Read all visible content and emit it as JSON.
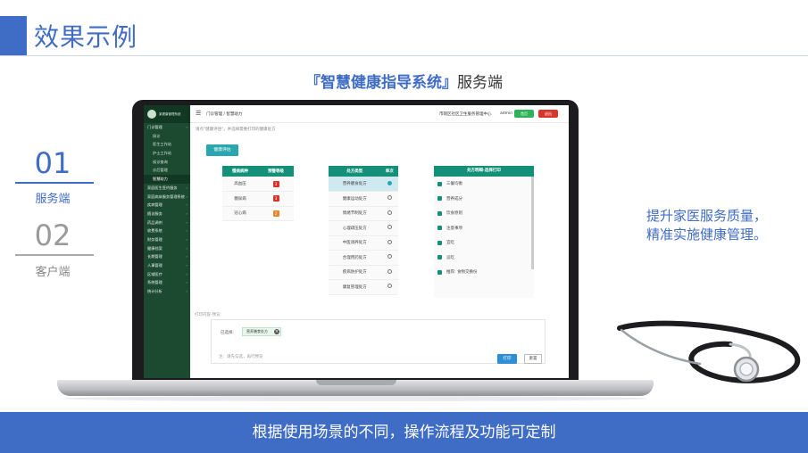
{
  "header": {
    "title": "效果示例"
  },
  "subtitle": {
    "brand": "『智慧健康指导系统』",
    "suffix": "服务端"
  },
  "left_nav": [
    {
      "number": "01",
      "label": "服务端",
      "active": true
    },
    {
      "number": "02",
      "label": "客户端",
      "active": false
    }
  ],
  "colors": {
    "accent": "#3f6cc4",
    "sidebar": "#1b4a30",
    "table_header": "#149078",
    "teal": "#2aa7ae"
  },
  "app": {
    "brand": "某健康管理系统",
    "sidebar": [
      {
        "label": "门诊管理",
        "active": false,
        "level": 0
      },
      {
        "label": "接诊",
        "active": false,
        "level": 1
      },
      {
        "label": "医生工作站",
        "active": false,
        "level": 1
      },
      {
        "label": "护士工作站",
        "active": false,
        "level": 1
      },
      {
        "label": "候诊查询",
        "active": false,
        "level": 1
      },
      {
        "label": "诊后管理",
        "active": false,
        "level": 1
      },
      {
        "label": "智慧助力",
        "active": true,
        "level": 1
      },
      {
        "label": "家庭医生签约服务",
        "active": false,
        "level": 0
      },
      {
        "label": "家庭病床服务管理系统",
        "active": false,
        "level": 0
      },
      {
        "label": "疾病管理",
        "active": false,
        "level": 0
      },
      {
        "label": "随访服务",
        "active": false,
        "level": 0
      },
      {
        "label": "药品调剂",
        "active": false,
        "level": 0
      },
      {
        "label": "收费系统",
        "active": false,
        "level": 0
      },
      {
        "label": "财务管理",
        "active": false,
        "level": 0
      },
      {
        "label": "健康档案",
        "active": false,
        "level": 0
      },
      {
        "label": "长期管理",
        "active": false,
        "level": 0
      },
      {
        "label": "人事管理",
        "active": false,
        "level": 0
      },
      {
        "label": "区域医疗",
        "active": false,
        "level": 0
      },
      {
        "label": "系统管理",
        "active": false,
        "level": 0
      },
      {
        "label": "统计分析",
        "active": false,
        "level": 0
      }
    ],
    "topbar": {
      "menu_icon": "☰",
      "breadcrumb": "门诊管理 / 智慧助力",
      "org": "市辖区社区卫生服务管理中心",
      "user": "admin",
      "btn_green": "首页",
      "btn_red": "退出"
    },
    "tip": "请点\"健康评估\"，并选择需要打印的健康处方",
    "assess_button": "健康评估",
    "disease_table": {
      "headers": [
        "慢病病种",
        "预警等级"
      ],
      "rows": [
        {
          "name": "高血压",
          "level": "3",
          "color": "#d9342b"
        },
        {
          "name": "糖尿病",
          "level": "3",
          "color": "#d9342b"
        },
        {
          "name": "冠心病",
          "level": "2",
          "color": "#e7852a"
        }
      ]
    },
    "prescription_table": {
      "headers": [
        "处方类型",
        "单次"
      ],
      "rows": [
        {
          "name": "营养膳食处方",
          "selected": true
        },
        {
          "name": "健康运动处方",
          "selected": false
        },
        {
          "name": "情绪节制处方",
          "selected": false
        },
        {
          "name": "心理疏压处方",
          "selected": false
        },
        {
          "name": "中医调养处方",
          "selected": false
        },
        {
          "name": "合理用药处方",
          "selected": false
        },
        {
          "name": "疾病防护处方",
          "selected": false
        },
        {
          "name": "康复管理处方",
          "selected": false
        }
      ]
    },
    "detail_table": {
      "header": "处方明细-选择打印",
      "rows": [
        "三餐均衡",
        "营养成分",
        "饮食原则",
        "注意事项",
        "宜吃",
        "忌吃",
        "推荐: 食物交换份"
      ]
    },
    "print_section": {
      "label": "打印内容-预览:",
      "field_label": "已选择:",
      "tag": "营养膳食处方",
      "note": "注：请先勾选，再行预览",
      "print_btn": "打印",
      "reset_btn": "重置"
    }
  },
  "right_text": {
    "line1": "提升家医服务质量，",
    "line2": "精准实施健康管理。"
  },
  "footer": {
    "text": "根据使用场景的不同，操作流程及功能可定制"
  }
}
